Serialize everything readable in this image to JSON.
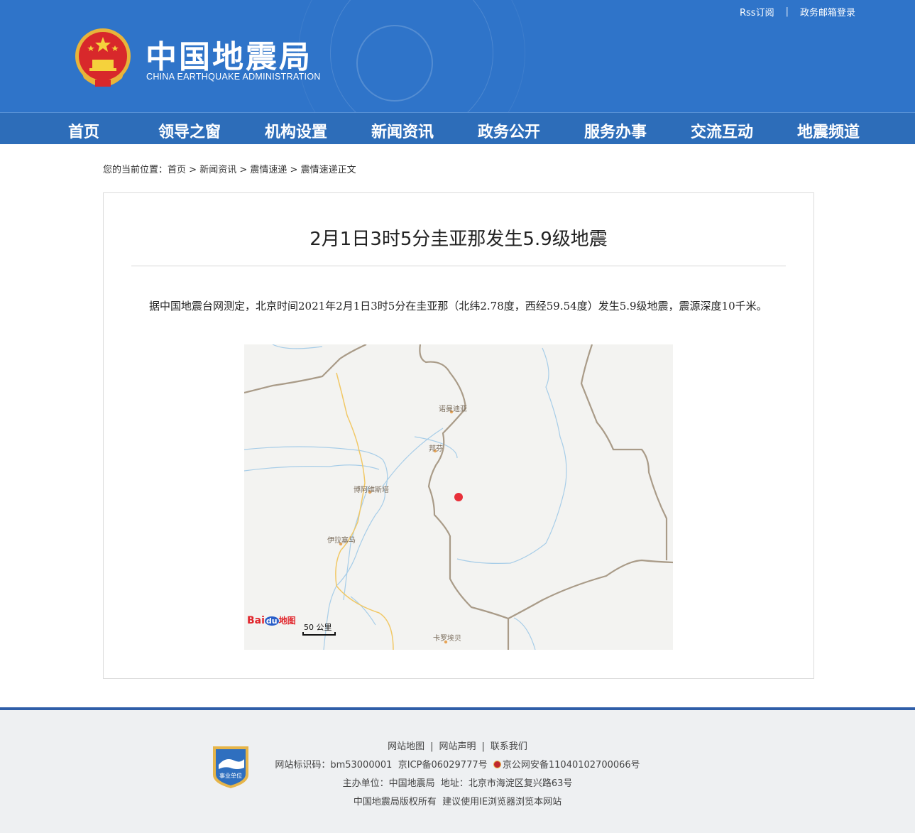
{
  "header": {
    "title_cn": "中国地震局",
    "title_en": "CHINA EARTHQUAKE ADMINISTRATION",
    "top_links": [
      "Rss订阅",
      "政务邮箱登录"
    ],
    "colors": {
      "header_bg": "#2f74c9",
      "nav_bg": "#2d6db9"
    }
  },
  "nav": {
    "items": [
      "首页",
      "领导之窗",
      "机构设置",
      "新闻资讯",
      "政务公开",
      "服务办事",
      "交流互动",
      "地震频道"
    ]
  },
  "breadcrumb": {
    "prefix": "您的当前位置：",
    "items": [
      "首页",
      "新闻资讯",
      "震情速递",
      "震情速递正文"
    ],
    "separator": " > "
  },
  "article": {
    "title": "2月1日3时5分圭亚那发生5.9级地震",
    "body": "据中国地震台网测定，北京时间2021年2月1日3时5分在圭亚那（北纬2.78度，西经59.54度）发生5.9级地震，震源深度10千米。"
  },
  "map": {
    "places": [
      "诺曼迪亚",
      "邦芬",
      "博阿维斯塔",
      "伊拉塞马",
      "卡罗埃贝"
    ],
    "scale_label": "50 公里",
    "logo_text": {
      "bai": "Bai",
      "du": "du",
      "map": "地图"
    },
    "epicenter_color": "#e8303a"
  },
  "footer": {
    "links": [
      "网站地图",
      "网站声明",
      "联系我们"
    ],
    "site_id": "网站标识码：bm53000001",
    "icp": "京ICP备06029777号",
    "police": "京公网安备11040102700066号",
    "host": "主办单位：中国地震局",
    "address": "地址：北京市海淀区复兴路63号",
    "copyright": "中国地震局版权所有",
    "browser_tip": "建议使用IE浏览器浏览本网站",
    "badge_text": "事业单位"
  }
}
